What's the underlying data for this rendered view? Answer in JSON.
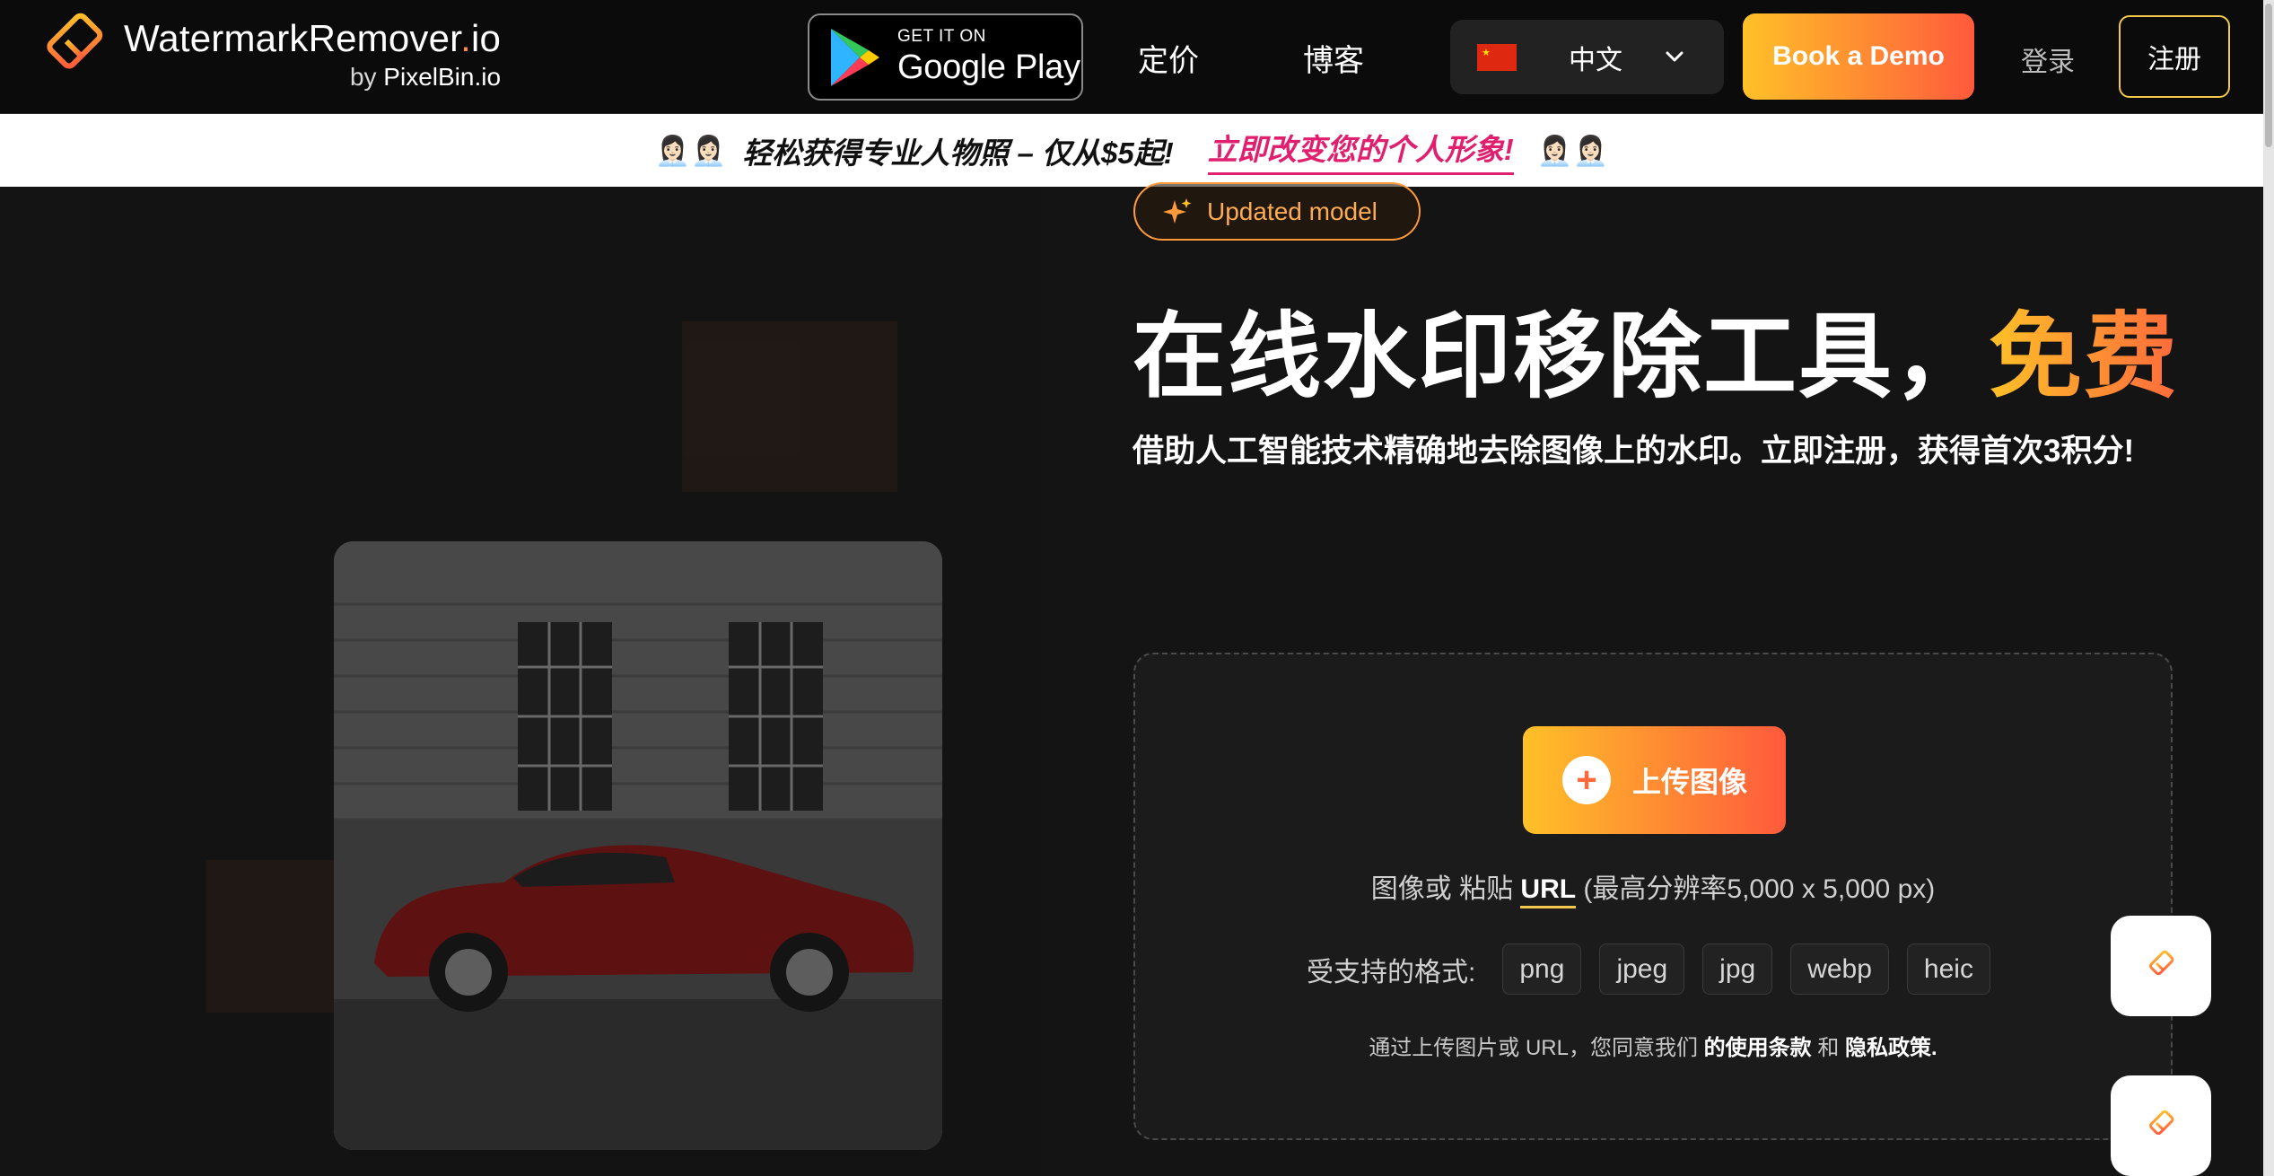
{
  "header": {
    "logo_title_main": "WatermarkRemover",
    "logo_title_dot": ".",
    "logo_title_tld": "io",
    "logo_sub_by": "by",
    "logo_sub_brand": "PixelBin.io",
    "gplay_small": "GET IT ON",
    "gplay_big": "Google Play",
    "nav": [
      {
        "label": "定价"
      },
      {
        "label": "博客"
      }
    ],
    "language": {
      "label": "中文"
    },
    "demo_label": "Book a Demo",
    "login_label": "登录",
    "signup_label": "注册"
  },
  "banner": {
    "emoji_left": "👩🏻‍💼👩🏻‍💼",
    "text": "轻松获得专业人物照 – 仅从$5起!",
    "link": "立即改变您的个人形象!",
    "emoji_right": "👩🏻‍💼👩🏻‍💼"
  },
  "hero": {
    "badge": "Updated model",
    "title_main": "在线水印移除工具，",
    "title_accent": "免费",
    "subtitle": "借助人工智能技术精确地去除图像上的水印。立即注册，获得首次3积分!"
  },
  "upload": {
    "button_label": "上传图像",
    "plus": "+",
    "url_prefix": "图像或 粘贴",
    "url_link": "URL",
    "url_suffix": "(最高分辨率5,000 x 5,000 px)",
    "formats_label": "受支持的格式:",
    "formats": [
      "png",
      "jpeg",
      "jpg",
      "webp",
      "heic"
    ],
    "terms_prefix": "通过上传图片或 URL，您同意我们",
    "terms_link": "的使用条款",
    "terms_and": "和",
    "privacy_link": "隐私政策."
  },
  "colors": {
    "accent_start": "#ffc128",
    "accent_end": "#ff5a3c",
    "banner_link": "#e0206e",
    "badge": "#ff9a3c",
    "background": "#141414"
  },
  "icons": [
    "logo-eraser-icon",
    "google-play-icon",
    "china-flag-icon",
    "chevron-down-icon",
    "sparkle-icon",
    "plus-icon",
    "eraser-icon"
  ]
}
